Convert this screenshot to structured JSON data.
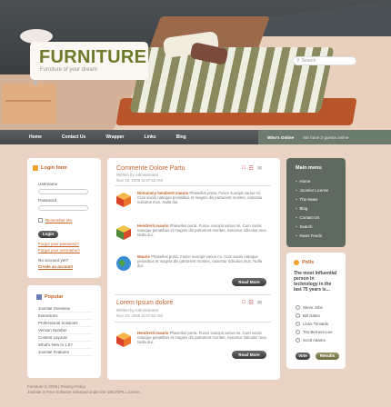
{
  "brand": {
    "logo": "FURNITURE",
    "tagline": "Furniture of your dream"
  },
  "search": {
    "placeholder": "Search"
  },
  "nav": [
    "Home",
    "Contact Us",
    "Wrapper",
    "Links",
    "Blog"
  ],
  "who": {
    "title": "Who's Online",
    "text": "We have 2 guests online"
  },
  "login": {
    "title": "Login form",
    "username": "Username",
    "password": "Password",
    "remember": "Remember Me",
    "login": "Login",
    "forgot_password": "Forgot your password?",
    "forgot_username": "Forgot your username?",
    "no_account": "No account yet?",
    "create": "Create an account"
  },
  "popular": {
    "title": "Popular",
    "items": [
      "Joomla! Overview",
      "Extensions",
      "Professional Solutions",
      "Version Number",
      "Content Layouts",
      "What's New in 1.5?",
      "Joomla! Features"
    ]
  },
  "articles": [
    {
      "title": "Commente Dolore Partu",
      "author": "Written by Administrator",
      "date": "Nov 19, 2008 at 07:52 AM",
      "items": [
        {
          "head": "Nonummy hendrerit mauris",
          "text": "Phasellus porta. Fusce suscipit varius mi. Cum sociis natoque penatibus et magnis dis parturient montes, nascetur ridiculus mus. Nulla dui."
        },
        {
          "head": "Hendrerit mauris",
          "text": "Phasellus porta. Fusce suscipit varius mi. Cum sociis natoque penatibus et magnis dis parturient montes, nascetur ridiculus mus. Nulla dui."
        },
        {
          "head": "Mauris",
          "text": "Phasellus porta. Fusce suscipit varius mi. Cum sociis natoque penatibus et magnis dis parturient montes, nascetur ridiculus mus. Nulla dui."
        }
      ],
      "readmore": "Read More"
    },
    {
      "title": "Lorem Ipsum dolore",
      "author": "Written by Administrator",
      "date": "Nov 19, 2008 at 07:52 AM",
      "items": [
        {
          "head": "Hendrerit mauris",
          "text": "Phasellus porta. Fusce suscipit varius mi. Cum sociis natoque penatibus et magnis dis parturient montes, nascetur ridiculus mus. Nulla dui."
        }
      ],
      "readmore": "Read More"
    }
  ],
  "menu": {
    "title": "Main menu",
    "items": [
      "Home",
      "Joomla! License",
      "The News",
      "Blog",
      "Contact Us",
      "Search",
      "News Feeds"
    ]
  },
  "polls": {
    "title": "Polls",
    "question": "The most influential person in technology in the last 75 years is...",
    "options": [
      "Steve Jobs",
      "Bill Gates",
      "Linus Torvalds",
      "Tim Berners-Lee",
      "Scott Adams"
    ],
    "vote": "Vote",
    "results": "Results"
  },
  "footer": {
    "line1": "Furniture © 2009 | Privacy Policy",
    "line2": "Joomla! is Free Software released under the GNU/GPL License."
  }
}
